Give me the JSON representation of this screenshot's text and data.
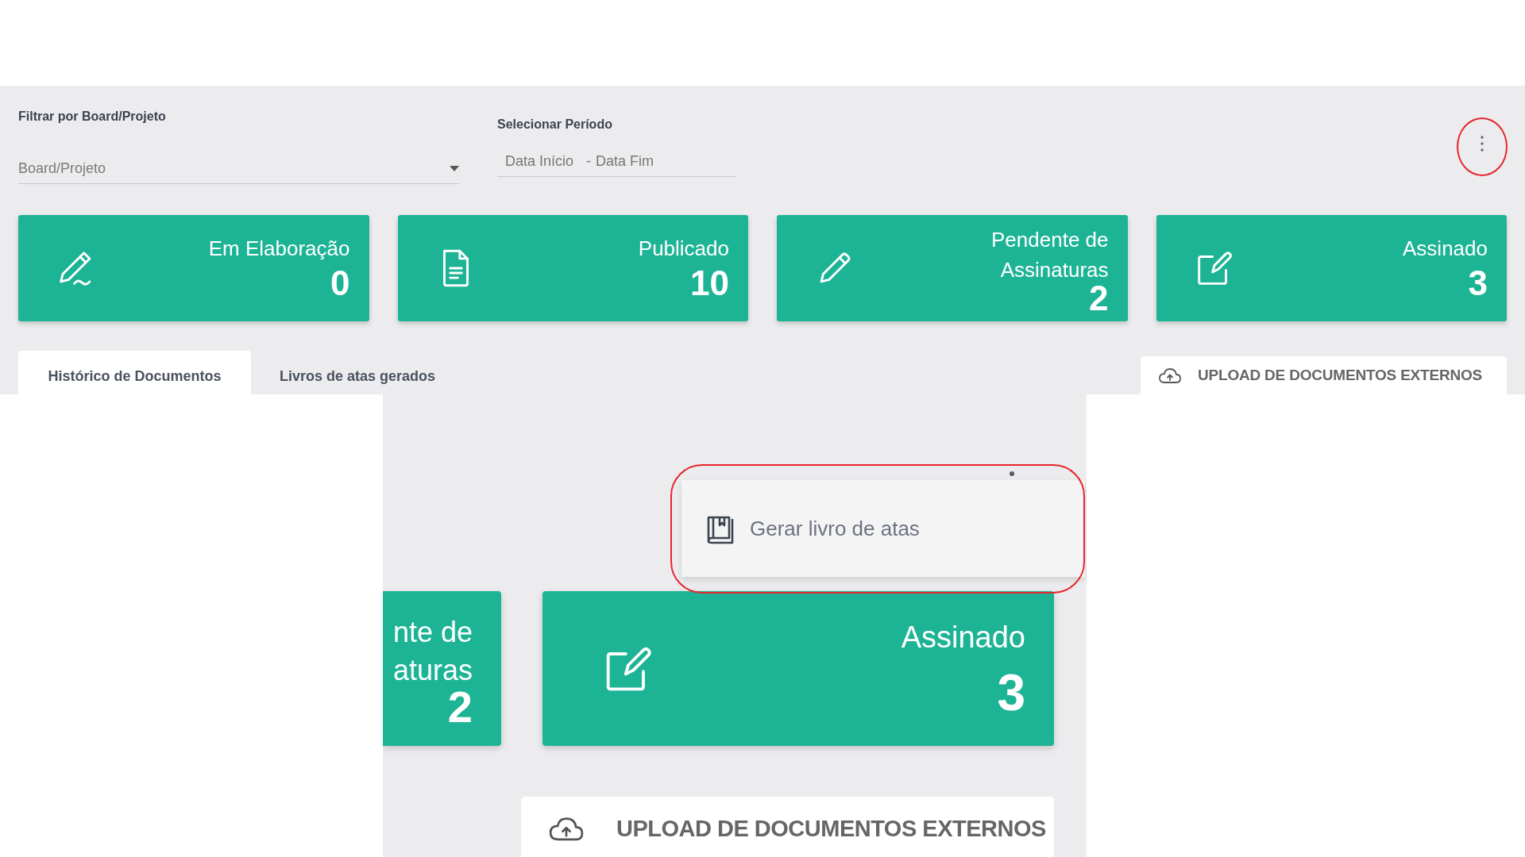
{
  "filter": {
    "label": "Filtrar por Board/Projeto",
    "placeholder": "Board/Projeto"
  },
  "period": {
    "label": "Selecionar Período",
    "start_placeholder": "Data Início",
    "separator": "-",
    "end_placeholder": "Data Fim"
  },
  "more_menu": {
    "highlighted": true
  },
  "cards": [
    {
      "kind": "signature",
      "title": "Em Elaboração",
      "count": "0"
    },
    {
      "kind": "document",
      "title": "Publicado",
      "count": "10"
    },
    {
      "kind": "pencil",
      "title": "Pendente de Assinaturas",
      "count": "2"
    },
    {
      "kind": "edit",
      "title": "Assinado",
      "count": "3"
    }
  ],
  "tabs": [
    {
      "label": "Histórico de Documentos",
      "selected": true
    },
    {
      "label": "Livros de atas gerados",
      "selected": false
    }
  ],
  "upload_button": {
    "label": "UPLOAD DE DOCUMENTOS EXTERNOS"
  },
  "zoom_view": {
    "menu": {
      "highlighted": true,
      "items": [
        {
          "label": "Gerar livro de atas"
        }
      ]
    },
    "partial_card": {
      "title_lines": [
        "nte de",
        "aturas"
      ],
      "count": "2"
    },
    "card": {
      "kind": "edit",
      "title": "Assinado",
      "count": "3"
    },
    "upload_button": {
      "label": "UPLOAD DE DOCUMENTOS EXTERNOS"
    }
  }
}
